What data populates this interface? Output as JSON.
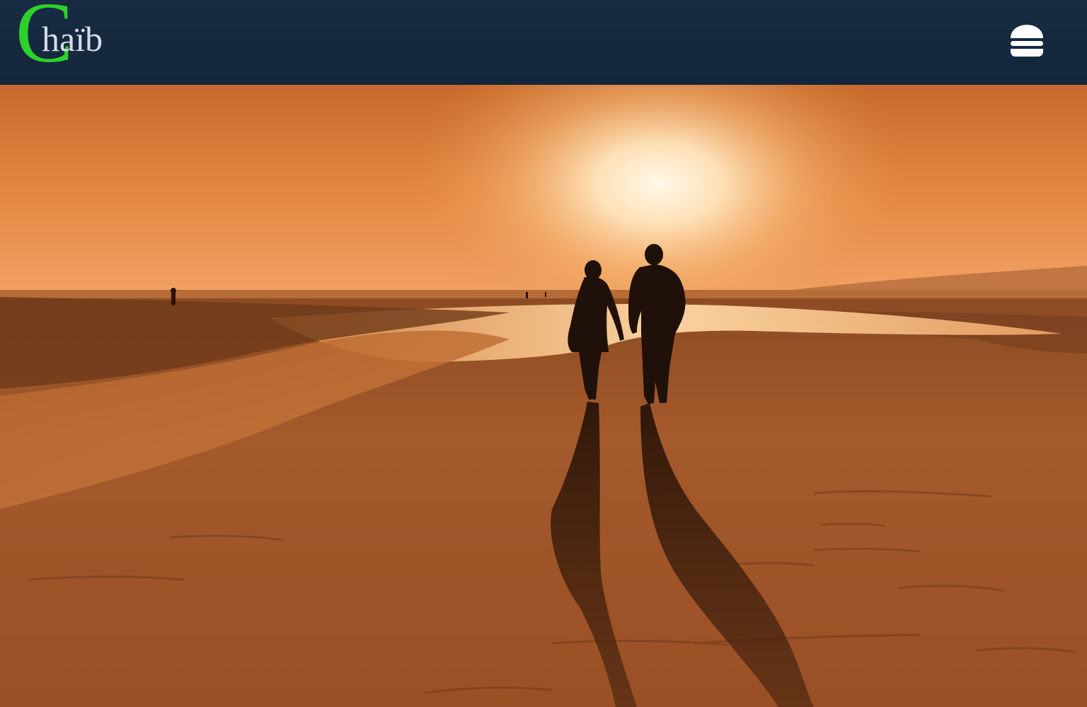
{
  "header": {
    "logo": {
      "initial": "C",
      "rest": "haïb",
      "initial_color": "#2ed02a",
      "rest_color": "#d5dde6"
    },
    "menu_icon": "burger-menu-icon",
    "background": "#13263b"
  },
  "hero": {
    "scene": "beach-sunset-couple-silhouette"
  }
}
